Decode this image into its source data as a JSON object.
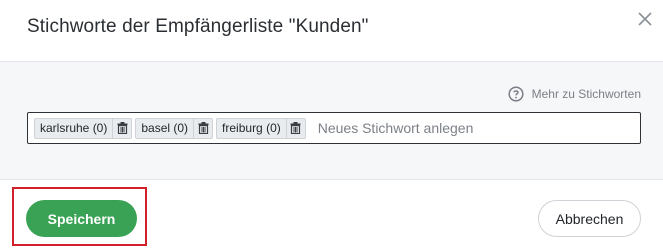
{
  "dialog": {
    "title": "Stichworte der Empfängerliste \"Kunden\"",
    "close_icon": "close-icon"
  },
  "help": {
    "icon": "question-circle-icon",
    "label": "Mehr zu Stichworten"
  },
  "tags": [
    {
      "label": "karlsruhe (0)",
      "icon": "trash-icon"
    },
    {
      "label": "basel (0)",
      "icon": "trash-icon"
    },
    {
      "label": "freiburg (0)",
      "icon": "trash-icon"
    }
  ],
  "new_tag": {
    "placeholder": "Neues Stichwort anlegen",
    "value": ""
  },
  "footer": {
    "save_label": "Speichern",
    "cancel_label": "Abbrechen"
  },
  "colors": {
    "primary": "#3aa254",
    "highlight": "#d0202a"
  }
}
